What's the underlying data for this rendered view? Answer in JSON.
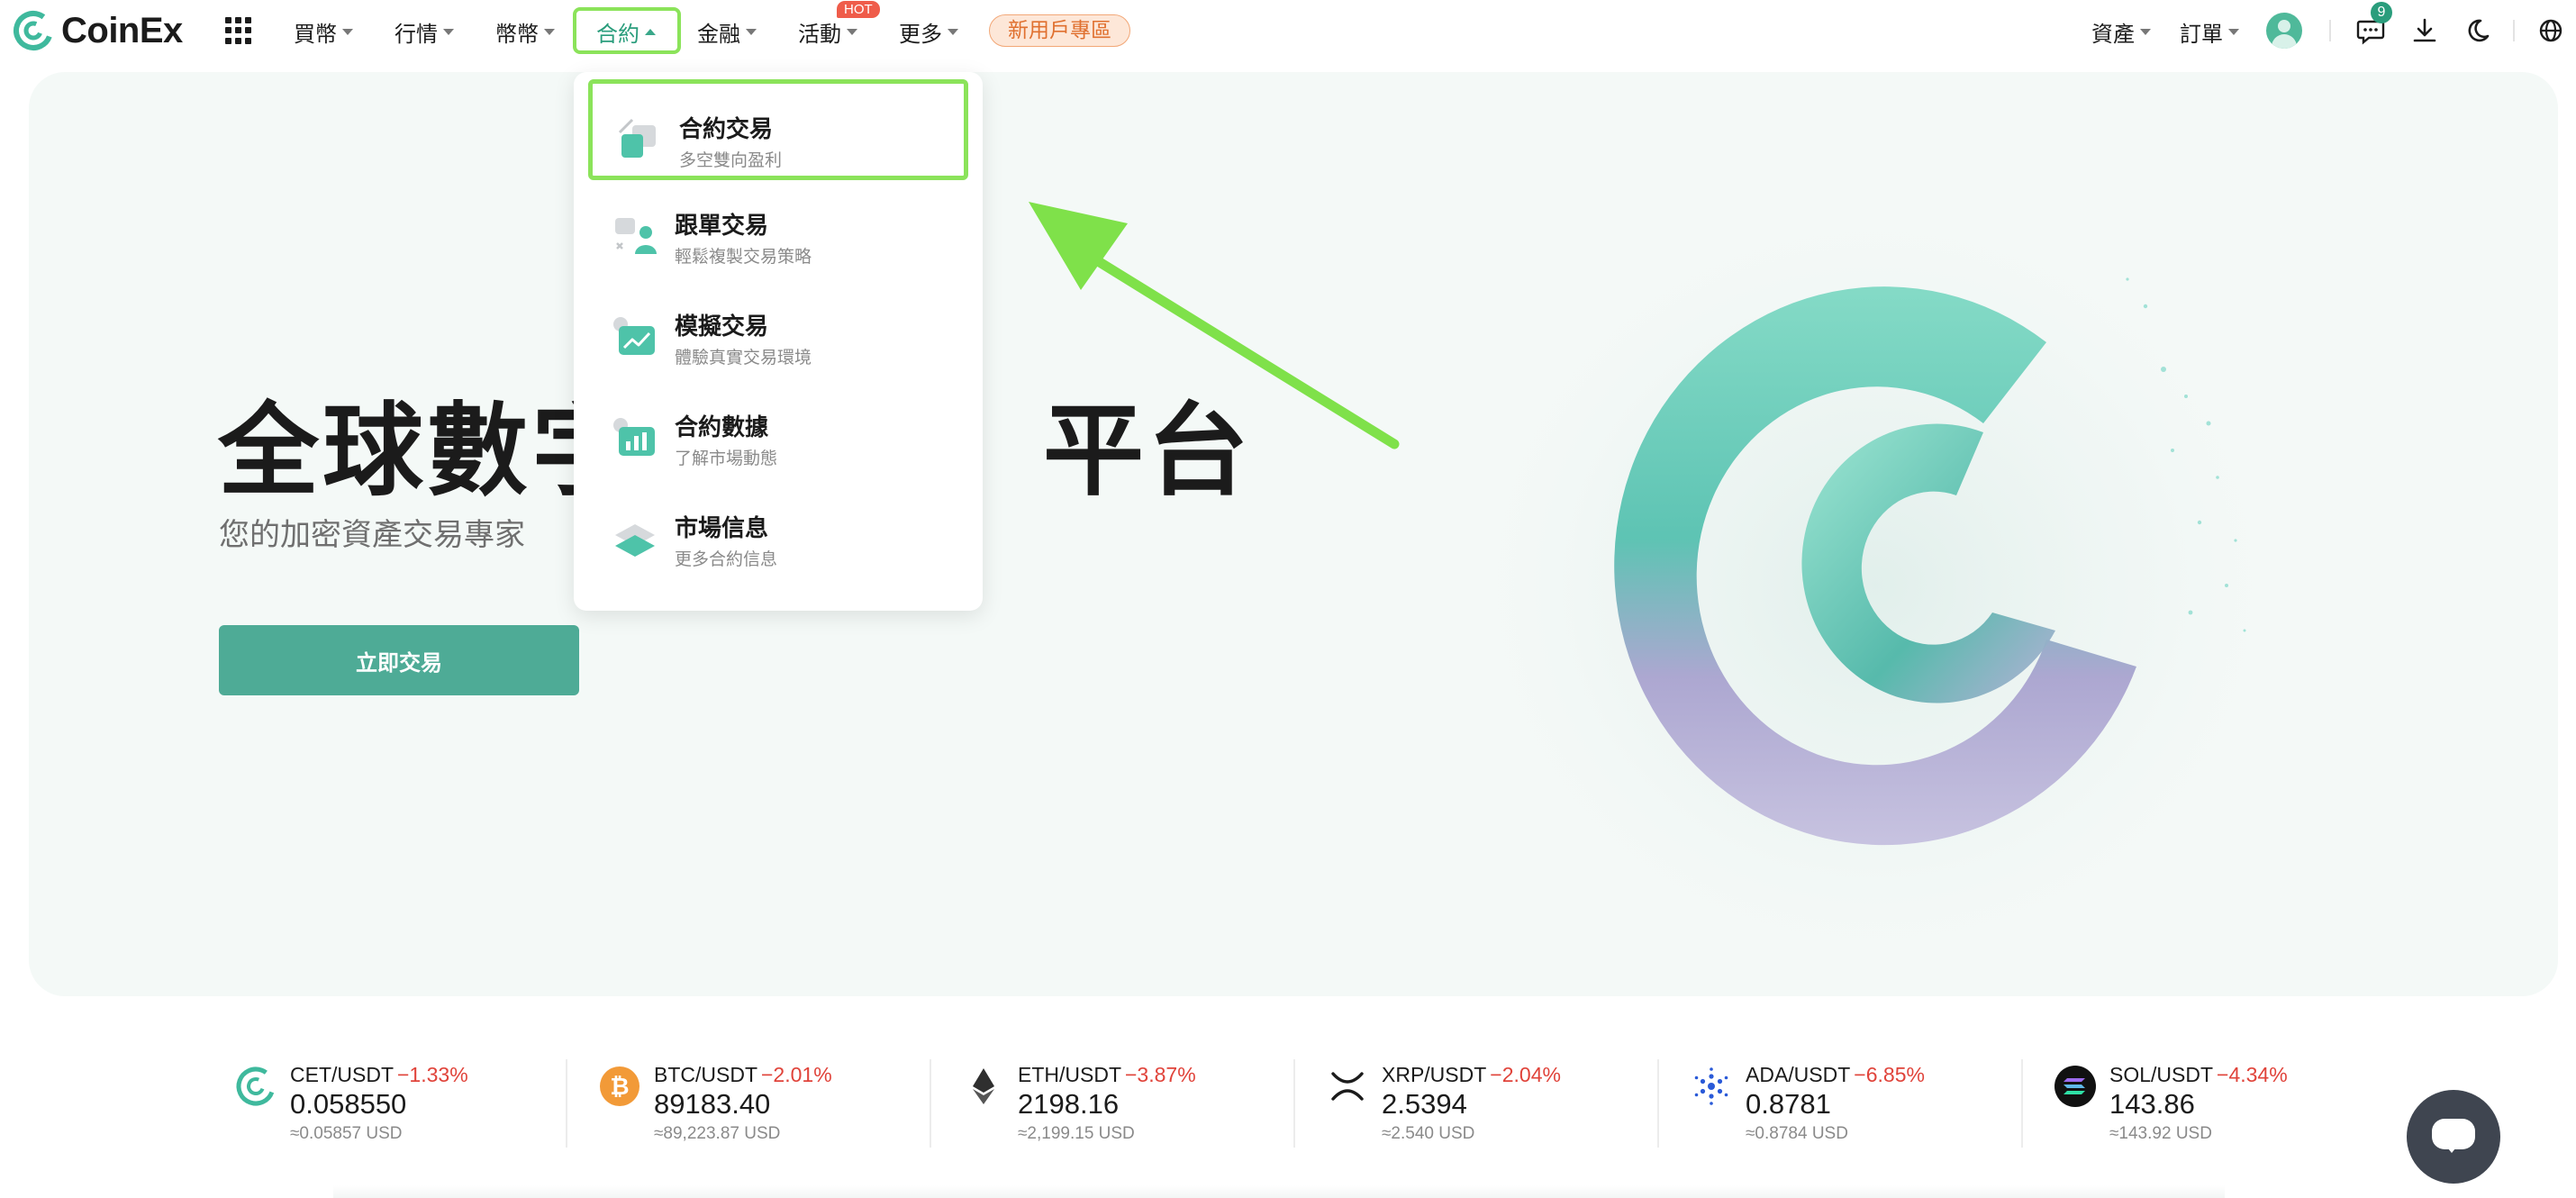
{
  "brand": {
    "name": "CoinEx",
    "accent": "#2a9d7c",
    "highlight": "#8be35a",
    "down": "#e0433a"
  },
  "nav": {
    "items": [
      {
        "label": "買幣"
      },
      {
        "label": "行情"
      },
      {
        "label": "幣幣"
      },
      {
        "label": "合約"
      },
      {
        "label": "金融"
      },
      {
        "label": "活動"
      },
      {
        "label": "更多"
      }
    ],
    "hot_badge": "HOT",
    "promo": "新用戶專區",
    "right": {
      "assets": "資產",
      "orders": "訂單",
      "message_count": "9"
    }
  },
  "dropdown": {
    "items": [
      {
        "title": "合約交易",
        "desc": "多空雙向盈利"
      },
      {
        "title": "跟單交易",
        "desc": "輕鬆複製交易策略"
      },
      {
        "title": "模擬交易",
        "desc": "體驗真實交易環境"
      },
      {
        "title": "合約數據",
        "desc": "了解市場動態"
      },
      {
        "title": "市場信息",
        "desc": "更多合約信息"
      }
    ]
  },
  "hero": {
    "title_left": "全球數字",
    "title_right": "平台",
    "subtitle": "您的加密資產交易專家",
    "cta": "立即交易"
  },
  "ticker": [
    {
      "pair": "CET/USDT",
      "change": "−1.33%",
      "price": "0.058550",
      "usd": "≈0.05857 USD",
      "icon": "cet-coin-icon"
    },
    {
      "pair": "BTC/USDT",
      "change": "−2.01%",
      "price": "89183.40",
      "usd": "≈89,223.87 USD",
      "icon": "btc-coin-icon"
    },
    {
      "pair": "ETH/USDT",
      "change": "−3.87%",
      "price": "2198.16",
      "usd": "≈2,199.15 USD",
      "icon": "eth-coin-icon"
    },
    {
      "pair": "XRP/USDT",
      "change": "−2.04%",
      "price": "2.5394",
      "usd": "≈2.540 USD",
      "icon": "xrp-coin-icon"
    },
    {
      "pair": "ADA/USDT",
      "change": "−6.85%",
      "price": "0.8781",
      "usd": "≈0.8784 USD",
      "icon": "ada-coin-icon"
    },
    {
      "pair": "SOL/USDT",
      "change": "−4.34%",
      "price": "143.86",
      "usd": "≈143.92 USD",
      "icon": "sol-coin-icon"
    }
  ]
}
